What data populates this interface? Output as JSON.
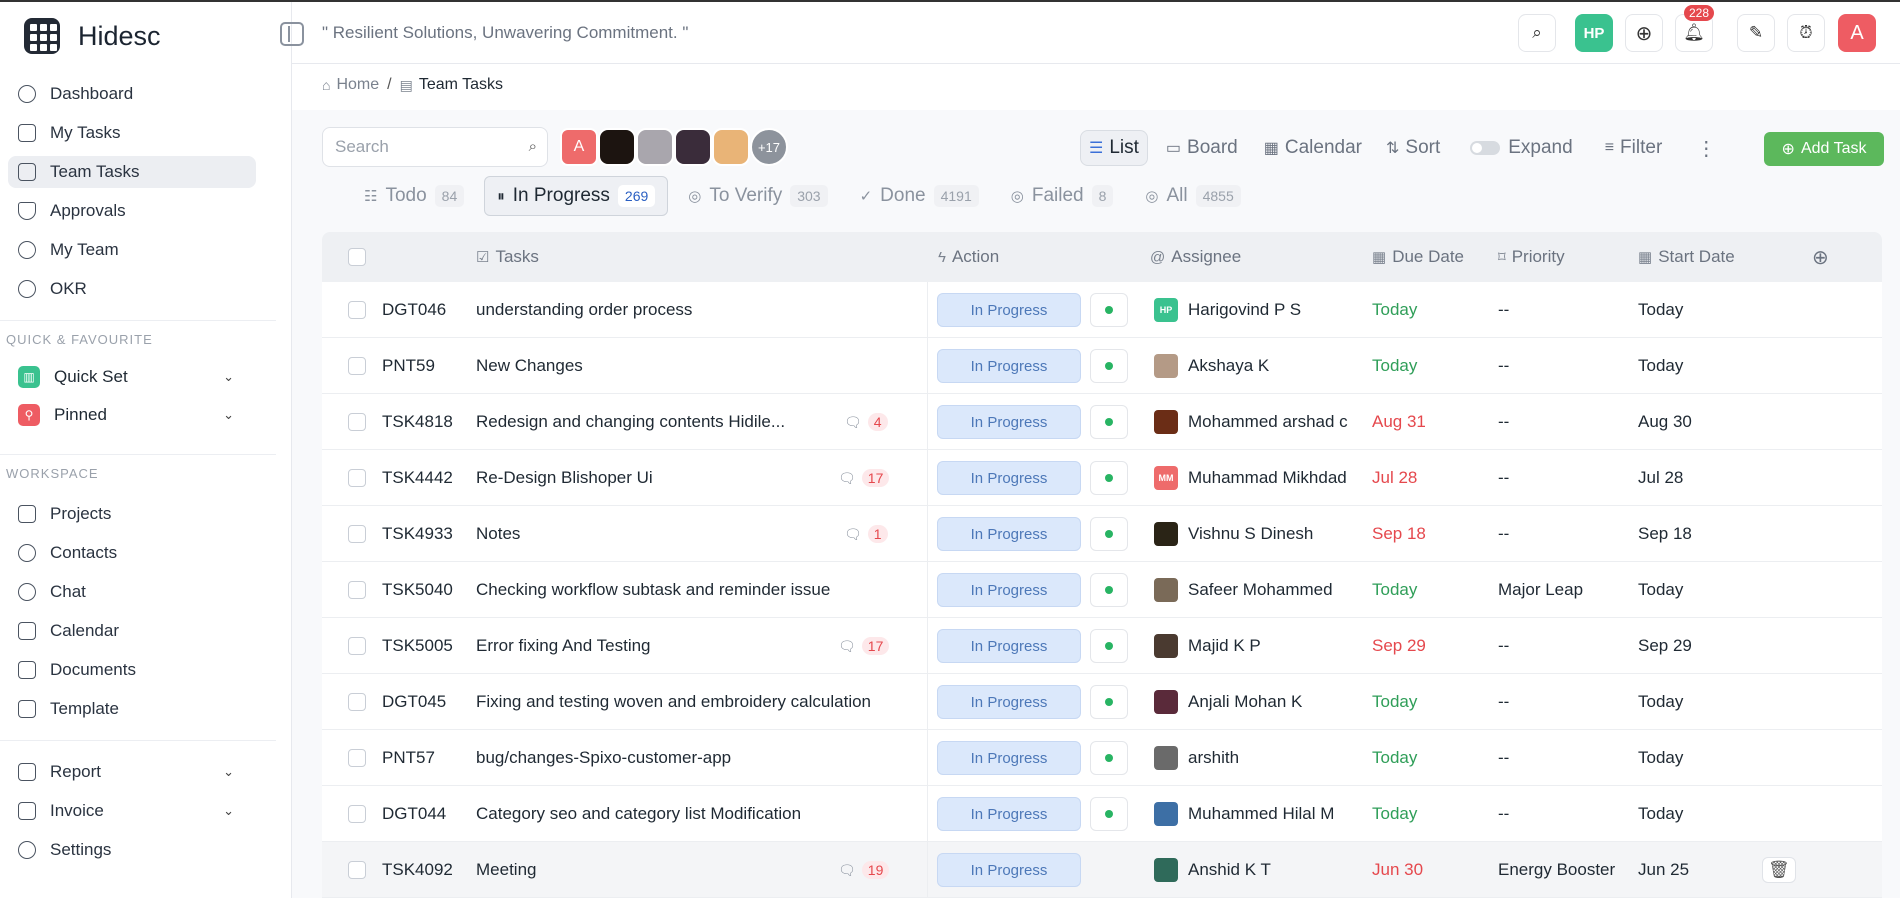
{
  "app": {
    "name": "Hidesc",
    "motto": "\" Resilient Solutions, Unwavering Commitment. \""
  },
  "sidebar": {
    "nav": [
      {
        "label": "Dashboard",
        "icon": "dashboard-icon"
      },
      {
        "label": "My Tasks",
        "icon": "document-icon"
      },
      {
        "label": "Team Tasks",
        "icon": "document-icon"
      },
      {
        "label": "Approvals",
        "icon": "shield-icon"
      },
      {
        "label": "My Team",
        "icon": "users-icon"
      },
      {
        "label": "OKR",
        "icon": "target-icon"
      }
    ],
    "quick_title": "QUICK & FAVOURITE",
    "quick": [
      {
        "label": "Quick Set",
        "color": "#3ac28f"
      },
      {
        "label": "Pinned",
        "color": "#ee5c63"
      }
    ],
    "workspace_title": "WORKSPACE",
    "workspace": [
      {
        "label": "Projects"
      },
      {
        "label": "Contacts"
      },
      {
        "label": "Chat"
      },
      {
        "label": "Calendar"
      },
      {
        "label": "Documents"
      },
      {
        "label": "Template"
      }
    ],
    "bottom": [
      {
        "label": "Report"
      },
      {
        "label": "Invoice"
      },
      {
        "label": "Settings"
      }
    ]
  },
  "header": {
    "user_initials": "HP",
    "notifications": "228",
    "profile_initial": "A"
  },
  "breadcrumb": {
    "home": "Home",
    "current": "Team Tasks"
  },
  "toolbar": {
    "search_placeholder": "Search",
    "first_avatar": "A",
    "more_avatars": "+17",
    "views": {
      "list": "List",
      "board": "Board",
      "calendar": "Calendar",
      "sort": "Sort",
      "expand": "Expand",
      "filter": "Filter"
    },
    "add_task": "Add Task"
  },
  "tabs": [
    {
      "label": "Todo",
      "count": "84"
    },
    {
      "label": "In Progress",
      "count": "269"
    },
    {
      "label": "To Verify",
      "count": "303"
    },
    {
      "label": "Done",
      "count": "4191"
    },
    {
      "label": "Failed",
      "count": "8"
    },
    {
      "label": "All",
      "count": "4855"
    }
  ],
  "table": {
    "headers": {
      "tasks": "Tasks",
      "action": "Action",
      "assignee": "Assignee",
      "due": "Due Date",
      "priority": "Priority",
      "start": "Start Date"
    },
    "rows": [
      {
        "id": "DGT046",
        "task": "understanding order process",
        "comments": "",
        "status": "In Progress",
        "assignee": "Harigovind P S",
        "av": "HP",
        "avcolor": "#3ac28f",
        "due": "Today",
        "due_color": "green",
        "priority": "--",
        "start": "Today"
      },
      {
        "id": "PNT59",
        "task": "New Changes",
        "comments": "",
        "status": "In Progress",
        "assignee": "Akshaya K",
        "av": "",
        "avcolor": "#b49a86",
        "due": "Today",
        "due_color": "green",
        "priority": "--",
        "start": "Today"
      },
      {
        "id": "TSK4818",
        "task": "Redesign and changing contents Hidile...",
        "comments": "4",
        "status": "In Progress",
        "assignee": "Mohammed arshad c",
        "av": "",
        "avcolor": "#6b2d16",
        "due": "Aug 31",
        "due_color": "red",
        "priority": "--",
        "start": "Aug 30"
      },
      {
        "id": "TSK4442",
        "task": "Re-Design Blishoper Ui",
        "comments": "17",
        "status": "In Progress",
        "assignee": "Muhammad Mikhdad",
        "av": "MM",
        "avcolor": "#ee6b6b",
        "due": "Jul 28",
        "due_color": "red",
        "priority": "--",
        "start": "Jul 28"
      },
      {
        "id": "TSK4933",
        "task": "Notes",
        "comments": "1",
        "status": "In Progress",
        "assignee": "Vishnu S Dinesh",
        "av": "",
        "avcolor": "#2a2416",
        "due": "Sep 18",
        "due_color": "red",
        "priority": "--",
        "start": "Sep 18"
      },
      {
        "id": "TSK5040",
        "task": "Checking workflow subtask and reminder issue",
        "comments": "",
        "status": "In Progress",
        "assignee": "Safeer Mohammed",
        "av": "",
        "avcolor": "#7a6a58",
        "due": "Today",
        "due_color": "green",
        "priority": "Major Leap",
        "start": "Today"
      },
      {
        "id": "TSK5005",
        "task": "Error fixing And Testing",
        "comments": "17",
        "status": "In Progress",
        "assignee": "Majid K P",
        "av": "",
        "avcolor": "#4a3a30",
        "due": "Sep 29",
        "due_color": "red",
        "priority": "--",
        "start": "Sep 29"
      },
      {
        "id": "DGT045",
        "task": "Fixing and testing woven and embroidery calculation",
        "comments": "",
        "status": "In Progress",
        "assignee": "Anjali Mohan K",
        "av": "",
        "avcolor": "#5a2a3a",
        "due": "Today",
        "due_color": "green",
        "priority": "--",
        "start": "Today"
      },
      {
        "id": "PNT57",
        "task": "bug/changes-Spixo-customer-app",
        "comments": "",
        "status": "In Progress",
        "assignee": "arshith",
        "av": "",
        "avcolor": "#6a6a6a",
        "due": "Today",
        "due_color": "green",
        "priority": "--",
        "start": "Today"
      },
      {
        "id": "DGT044",
        "task": "Category seo and category list Modification",
        "comments": "",
        "status": "In Progress",
        "assignee": "Muhammed Hilal M",
        "av": "",
        "avcolor": "#3d6fa5",
        "due": "Today",
        "due_color": "green",
        "priority": "--",
        "start": "Today"
      },
      {
        "id": "TSK4092",
        "task": "Meeting",
        "comments": "19",
        "status": "In Progress",
        "assignee": "Anshid K T",
        "av": "",
        "avcolor": "#2f6a5a",
        "due": "Jun 30",
        "due_color": "red",
        "priority": "Energy Booster",
        "start": "Jun 25"
      }
    ]
  }
}
